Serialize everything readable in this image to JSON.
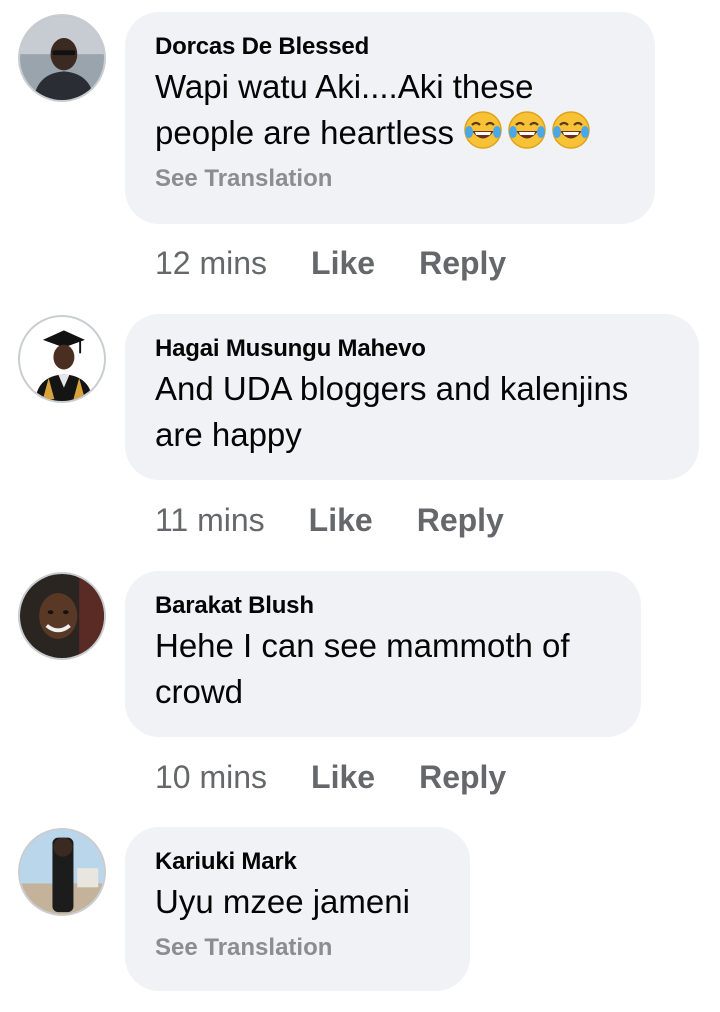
{
  "comments": [
    {
      "author": "Dorcas De Blessed",
      "text": "Wapi watu Aki....Aki these people are heartless",
      "emoji": [
        "face-with-tears-of-joy",
        "face-with-tears-of-joy",
        "face-with-tears-of-joy"
      ],
      "see_translation": "See Translation",
      "time": "12 mins",
      "like_label": "Like",
      "reply_label": "Reply"
    },
    {
      "author": "Hagai Musungu Mahevo",
      "text": "And UDA bloggers and kalenjins are happy",
      "time": "11 mins",
      "like_label": "Like",
      "reply_label": "Reply"
    },
    {
      "author": "Barakat Blush",
      "text": "Hehe I can see mammoth of crowd",
      "time": "10 mins",
      "like_label": "Like",
      "reply_label": "Reply"
    },
    {
      "author": "Kariuki Mark",
      "text": "Uyu mzee jameni",
      "see_translation": "See Translation"
    }
  ],
  "colors": {
    "bubble_bg": "#f0f2f5",
    "secondary_text": "#65676b",
    "see_translation": "#8a8d91"
  }
}
